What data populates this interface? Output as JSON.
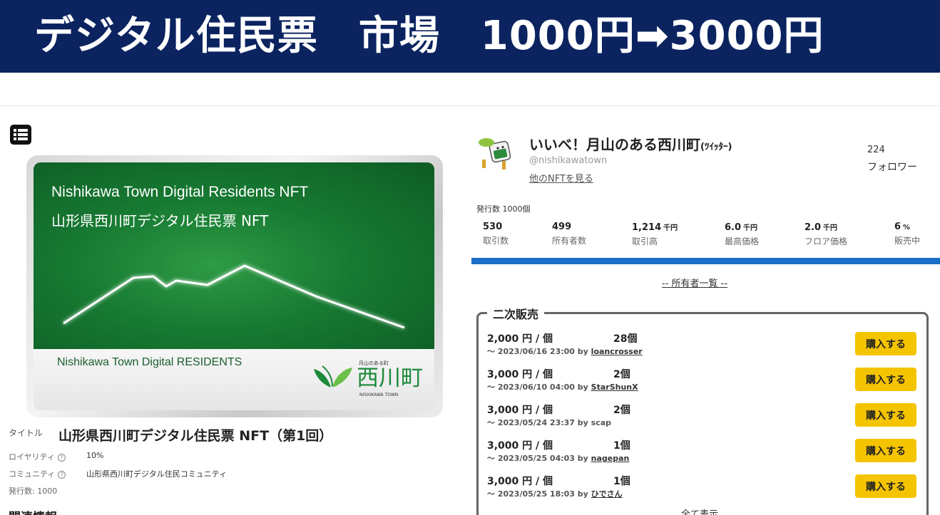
{
  "banner": {
    "text": "デジタル住民票　市場　1000円➡3000円"
  },
  "nft_card": {
    "title_en": "Nishikawa Town Digital Residents NFT",
    "title_jp": "山形県西川町デジタル住民票 NFT",
    "footer_text": "Nishikawa Town Digital RESIDENTS",
    "logo_small": "月山のある町",
    "logo_name": "西川町",
    "logo_en": "NISHIKAWA TOWN"
  },
  "details": {
    "title_label": "タイトル",
    "title_value": "山形県西川町デジタル住民票 NFT（第1回）",
    "royalty_label": "ロイヤリティ",
    "royalty_value": "10%",
    "community_label": "コミュニティ",
    "community_value": "山形県西川町デジタル住民コミュニティ",
    "issued": "発行数: 1000",
    "related_heading": "関連情報"
  },
  "account": {
    "name": "いいべ！月山のある西川町",
    "name_suffix": "(ﾂｲｯﾀｰ)",
    "handle": "@nishikawatown",
    "other_nft_link": "他のNFTを見る",
    "followers_count": "224",
    "followers_label": "フォロワー"
  },
  "stats": {
    "issued": "発行数 1000個",
    "items": [
      {
        "value": "530",
        "unit": "",
        "label": "取引数"
      },
      {
        "value": "499",
        "unit": "",
        "label": "所有者数"
      },
      {
        "value": "1,214",
        "unit": "千円",
        "label": "取引高"
      },
      {
        "value": "6.0",
        "unit": "千円",
        "label": "最高価格"
      },
      {
        "value": "2.0",
        "unit": "千円",
        "label": "フロア価格"
      },
      {
        "value": "6",
        "unit": "%",
        "label": "販売中"
      }
    ]
  },
  "owners_link": "-- 所有者一覧 --",
  "secondary": {
    "title": "二次販売",
    "buy_label": "購入する",
    "listings": [
      {
        "price": "2,000 円 / 個",
        "qty": "28個",
        "until": "～ 2023/06/16 23:00 by",
        "seller": "loancrosser"
      },
      {
        "price": "3,000 円 / 個",
        "qty": "2個",
        "until": "～ 2023/06/10 04:00 by",
        "seller": "StarShunX"
      },
      {
        "price": "3,000 円 / 個",
        "qty": "2個",
        "until": "～ 2023/05/24 23:37 by",
        "seller": "scap"
      },
      {
        "price": "3,000 円 / 個",
        "qty": "1個",
        "until": "～ 2023/05/25 04:03 by",
        "seller": "nagepan"
      },
      {
        "price": "3,000 円 / 個",
        "qty": "1個",
        "until": "～ 2023/05/25 18:03 by",
        "seller": "ひでさん"
      }
    ],
    "show_all": "全て表示"
  }
}
